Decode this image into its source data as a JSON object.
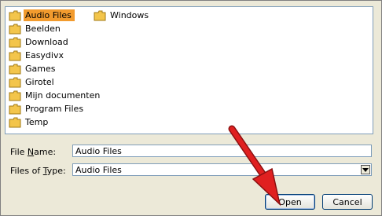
{
  "folders_column_1": [
    {
      "label": "Audio Files",
      "selected": true
    },
    {
      "label": "Beelden"
    },
    {
      "label": "Download"
    },
    {
      "label": "Easydivx"
    },
    {
      "label": "Games"
    },
    {
      "label": "Girotel"
    },
    {
      "label": "Mijn documenten"
    },
    {
      "label": "Program Files"
    },
    {
      "label": "Temp"
    }
  ],
  "folders_column_2": [
    {
      "label": "Windows"
    }
  ],
  "file_name": {
    "label_prefix": "File ",
    "label_accel": "N",
    "label_suffix": "ame:",
    "value": "Audio Files"
  },
  "file_type": {
    "label_prefix": "Files of ",
    "label_accel": "T",
    "label_suffix": "ype:",
    "value": "Audio Files"
  },
  "buttons": {
    "open": "Open",
    "cancel": "Cancel"
  },
  "colors": {
    "selection": "#f29b2e",
    "arrow": "#e02020"
  }
}
